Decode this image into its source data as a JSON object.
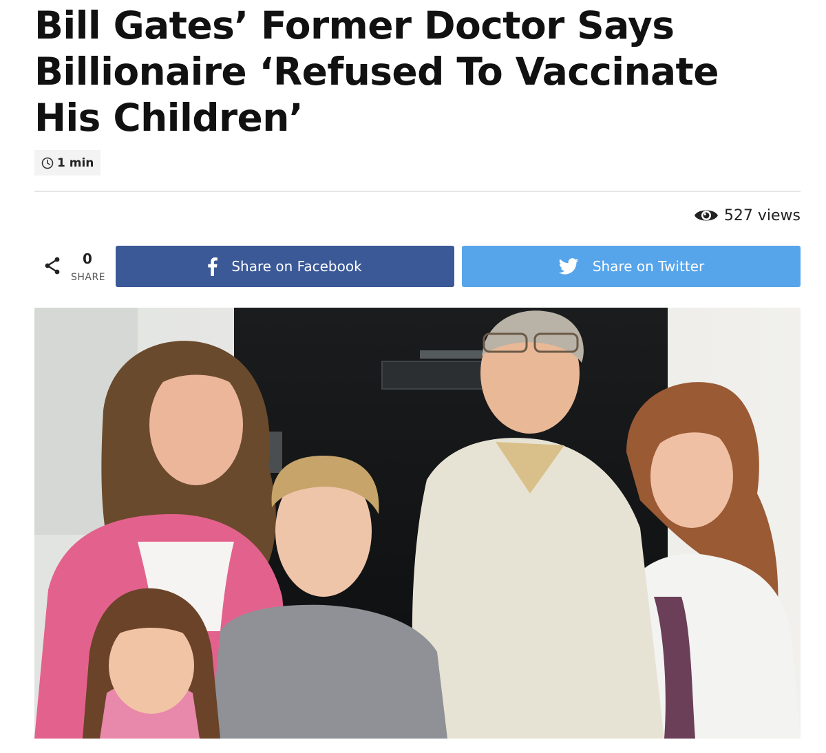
{
  "article": {
    "title_lines": [
      "Bill Gates’ Former Doctor Says",
      "Billionaire ‘Refused To Vaccinate",
      "His Children’"
    ],
    "read_time": "1 min",
    "views": "527 views"
  },
  "share": {
    "count": "0",
    "count_label": "SHARE",
    "facebook_label": "Share on Facebook",
    "twitter_label": "Share on Twitter"
  },
  "icons": {
    "read_time": "clock-icon",
    "views": "eye-icon",
    "share": "share-icon",
    "facebook": "facebook-icon",
    "twitter": "twitter-icon"
  },
  "colors": {
    "facebook": "#3b5997",
    "twitter": "#56a4ea",
    "headline": "#111111",
    "badge_bg": "#f3f3f3"
  }
}
